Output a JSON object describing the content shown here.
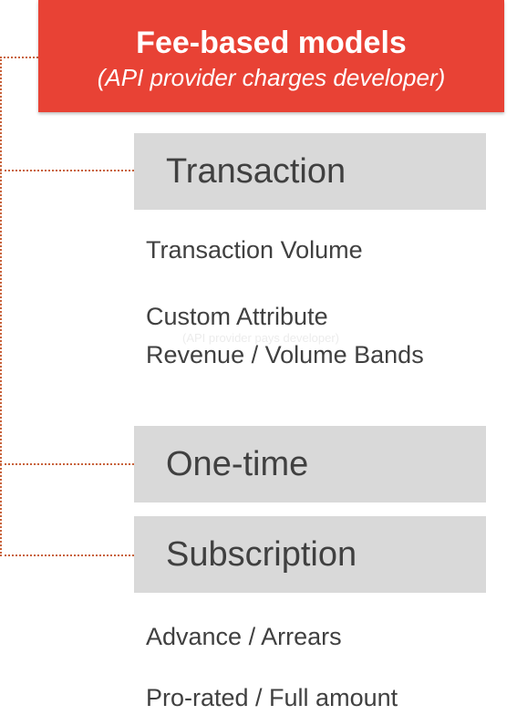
{
  "header": {
    "title": "Fee-based models",
    "subtitle": "(API provider charges developer)"
  },
  "categories": [
    {
      "label": "Transaction"
    },
    {
      "label": "One-time"
    },
    {
      "label": "Subscription"
    }
  ],
  "transaction_items": [
    "Transaction Volume",
    "Custom Attribute",
    "Revenue / Volume Bands"
  ],
  "ghost_text": "(API provider pays developer)",
  "subscription_items": [
    "Advance / Arrears",
    "Pro-rated / Full amount"
  ],
  "colors": {
    "header_bg": "#e84235",
    "category_bg": "#d9d9d9",
    "connector": "#c8623a"
  }
}
